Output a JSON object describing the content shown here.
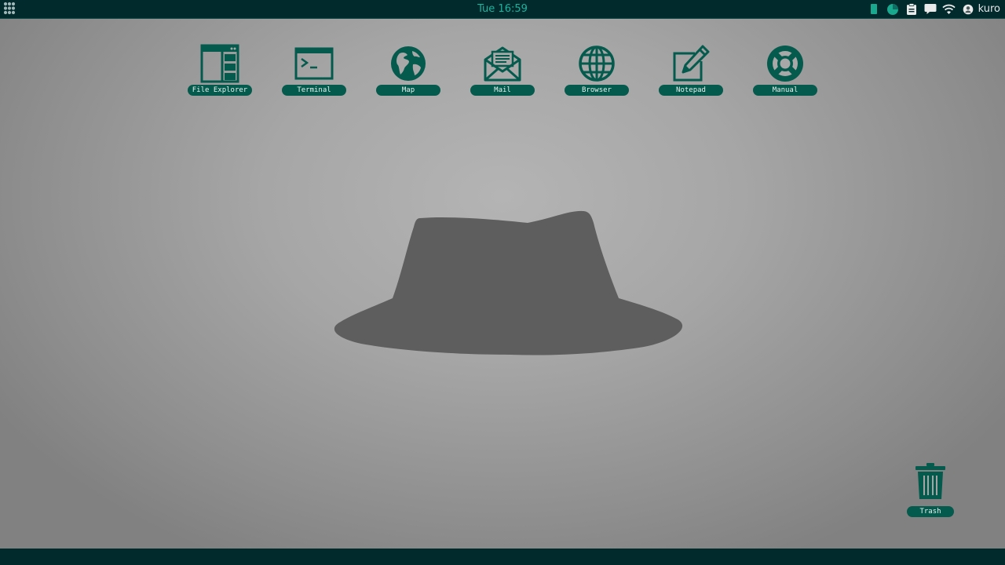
{
  "topbar": {
    "clock": "Tue 16:59",
    "user": "kuro",
    "tray_icons": [
      "battery-icon",
      "pie-status-icon",
      "clipboard-icon",
      "chat-icon",
      "wifi-icon",
      "user-icon"
    ]
  },
  "desktop": {
    "icons": [
      {
        "label": "File Explorer",
        "icon": "file-explorer-icon"
      },
      {
        "label": "Terminal",
        "icon": "terminal-icon"
      },
      {
        "label": "Map",
        "icon": "globe-map-icon"
      },
      {
        "label": "Mail",
        "icon": "mail-icon"
      },
      {
        "label": "Browser",
        "icon": "browser-globe-icon"
      },
      {
        "label": "Notepad",
        "icon": "notepad-icon"
      },
      {
        "label": "Manual",
        "icon": "lifebuoy-icon"
      }
    ],
    "trash": {
      "label": "Trash",
      "icon": "trash-icon"
    },
    "wallpaper": "fedora-hat"
  },
  "colors": {
    "accent": "#045a4c",
    "bar": "#012a2d",
    "clock": "#19b49e",
    "hat": "#5e5e5e"
  }
}
